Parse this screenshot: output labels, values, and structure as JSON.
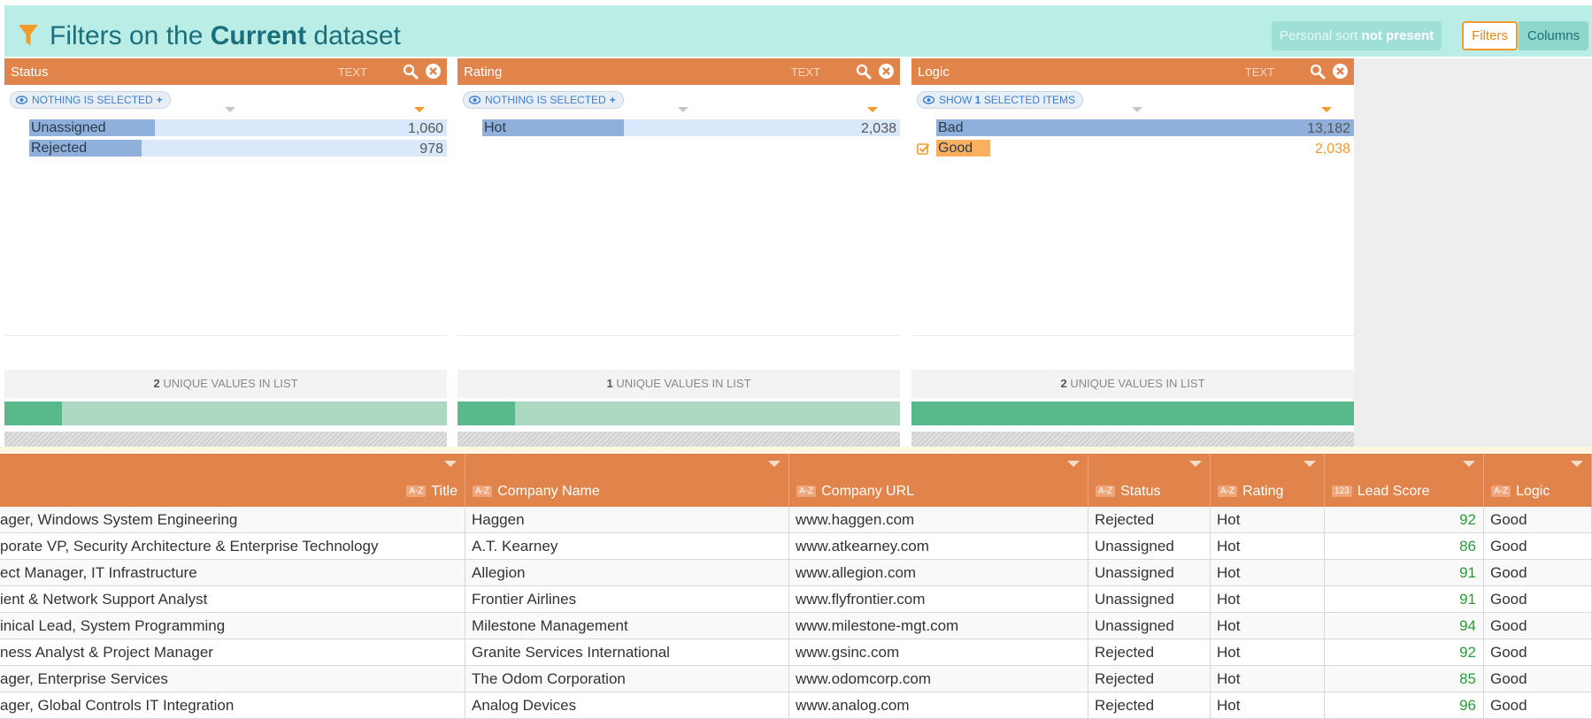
{
  "header": {
    "title_prefix": "Filters on the ",
    "title_bold": "Current",
    "title_suffix": " dataset",
    "sort_label": "Personal sort ",
    "sort_value": "not present",
    "filters_button": "Filters",
    "columns_button": "Columns"
  },
  "panels": [
    {
      "name": "Status",
      "type": "TEXT",
      "chip": "NOTHING IS SELECTED",
      "unique_count": "2",
      "unique_label": " UNIQUE VALUES IN LIST",
      "filter_fraction": 0.13,
      "items": [
        {
          "label": "Unassigned",
          "count": "1,060",
          "fraction": 0.3,
          "selected": false
        },
        {
          "label": "Rejected",
          "count": "978",
          "fraction": 0.27,
          "selected": false
        }
      ]
    },
    {
      "name": "Rating",
      "type": "TEXT",
      "chip": "NOTHING IS SELECTED",
      "unique_count": "1",
      "unique_label": " UNIQUE VALUES IN LIST",
      "filter_fraction": 0.13,
      "items": [
        {
          "label": "Hot",
          "count": "2,038",
          "fraction": 0.34,
          "selected": false
        }
      ]
    },
    {
      "name": "Logic",
      "type": "TEXT",
      "chip_prefix": "SHOW ",
      "chip_bold": "1",
      "chip_suffix": " SELECTED ITEMS",
      "unique_count": "2",
      "unique_label": " UNIQUE VALUES IN LIST",
      "filter_fraction": 1.0,
      "items": [
        {
          "label": "Bad",
          "count": "13,182",
          "fraction": 1.0,
          "selected": false
        },
        {
          "label": "Good",
          "count": "2,038",
          "fraction": 0.13,
          "selected": true
        }
      ]
    }
  ],
  "grid": {
    "columns": [
      {
        "label": "Title",
        "type": "A-Z"
      },
      {
        "label": "Company Name",
        "type": "A-Z"
      },
      {
        "label": "Company URL",
        "type": "A-Z"
      },
      {
        "label": "Status",
        "type": "A-Z"
      },
      {
        "label": "Rating",
        "type": "A-Z"
      },
      {
        "label": "Lead Score",
        "type": "123"
      },
      {
        "label": "Logic",
        "type": "A-Z"
      }
    ],
    "rows": [
      [
        "ager, Windows System Engineering",
        "Haggen",
        "www.haggen.com",
        "Rejected",
        "Hot",
        "92",
        "Good"
      ],
      [
        "porate VP, Security Architecture & Enterprise Technology",
        "A.T. Kearney",
        "www.atkearney.com",
        "Unassigned",
        "Hot",
        "86",
        "Good"
      ],
      [
        "ect Manager, IT Infrastructure",
        "Allegion",
        "www.allegion.com",
        "Unassigned",
        "Hot",
        "91",
        "Good"
      ],
      [
        "ient & Network Support Analyst",
        "Frontier Airlines",
        "www.flyfrontier.com",
        "Unassigned",
        "Hot",
        "91",
        "Good"
      ],
      [
        "inical Lead, System Programming",
        "Milestone Management",
        "www.milestone-mgt.com",
        "Unassigned",
        "Hot",
        "94",
        "Good"
      ],
      [
        "ness Analyst & Project Manager",
        "Granite Services International",
        "www.gsinc.com",
        "Rejected",
        "Hot",
        "92",
        "Good"
      ],
      [
        "ager, Enterprise Services",
        "The Odom Corporation",
        "www.odomcorp.com",
        "Rejected",
        "Hot",
        "85",
        "Good"
      ],
      [
        "ager, Global Controls IT Integration",
        "Analog Devices",
        "www.analog.com",
        "Rejected",
        "Hot",
        "96",
        "Good"
      ]
    ]
  },
  "colors": {
    "accent": "#e0844c",
    "header_bg": "#b9ede6",
    "title_color": "#1b6f7d",
    "score_green": "#2f9a3c"
  },
  "icons": {
    "funnel": "funnel-icon",
    "search": "search-icon",
    "close": "close-icon",
    "eye": "eye-icon",
    "check": "checkbox-icon"
  }
}
